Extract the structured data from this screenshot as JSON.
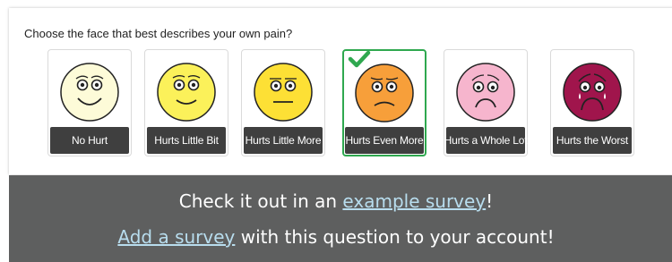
{
  "question": {
    "text": "Choose the face that best describes your own pain?"
  },
  "choices": [
    {
      "label": "No Hurt",
      "face_color": "#fdfbd8",
      "icon": "no-hurt-face-icon",
      "selected": false
    },
    {
      "label": "Hurts Little Bit",
      "face_color": "#fbf15a",
      "icon": "hurts-little-bit-face-icon",
      "selected": false
    },
    {
      "label": "Hurts Little More",
      "face_color": "#fde035",
      "icon": "hurts-little-more-face-icon",
      "selected": false
    },
    {
      "label": "Hurts Even More",
      "face_color": "#f79f3a",
      "icon": "hurts-even-more-face-icon",
      "selected": true
    },
    {
      "label": "Hurts a Whole Lot",
      "face_color": "#f6b5cd",
      "icon": "hurts-whole-lot-face-icon",
      "selected": false
    },
    {
      "label": "Hurts the Worst",
      "face_color": "#a0154c",
      "icon": "hurts-worst-face-icon",
      "selected": false
    }
  ],
  "colors": {
    "selected_border": "#2fa84f",
    "label_background": "#3f3f3f",
    "footer_background": "#5e5f5f",
    "link": "#b8ddee"
  },
  "footer": {
    "line1_before": "Check it out in an ",
    "line1_link": "example survey",
    "line1_after": "!",
    "line2_link": "Add a survey",
    "line2_after": " with this question to your account!"
  }
}
